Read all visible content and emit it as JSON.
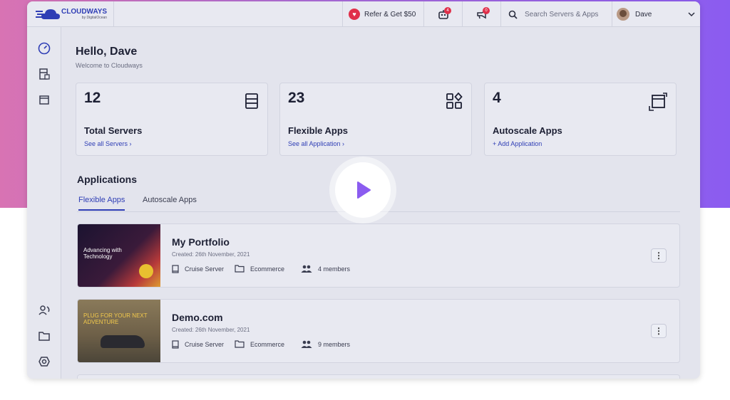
{
  "brand": {
    "name": "CLOUDWAYS",
    "sub": "by DigitalOcean"
  },
  "topbar": {
    "refer_label": "Refer & Get $50",
    "bot_badge": "4",
    "announce_badge": "0",
    "search_placeholder": "Search Servers & Apps",
    "user_name": "Dave"
  },
  "greeting": {
    "title": "Hello, Dave",
    "subtitle": "Welcome to Cloudways"
  },
  "stats": [
    {
      "value": "12",
      "label": "Total Servers",
      "link": "See all Servers ›"
    },
    {
      "value": "23",
      "label": "Flexible Apps",
      "link": "See all Application ›"
    },
    {
      "value": "4",
      "label": "Autoscale Apps",
      "link": "+ Add Application"
    }
  ],
  "applications": {
    "title": "Applications",
    "tabs": [
      "Flexible Apps",
      "Autoscale Apps"
    ],
    "items": [
      {
        "name": "My Portfolio",
        "created": "Created: 26th November, 2021",
        "server": "Cruise Server",
        "category": "Ecommerce",
        "members": "4 members",
        "thumb_text": "Advancing with Technology"
      },
      {
        "name": "Demo.com",
        "created": "Created: 26th November, 2021",
        "server": "Cruise Server",
        "category": "Ecommerce",
        "members": "9 members",
        "thumb_text": "PLUG FOR YOUR NEXT ADVENTURE"
      }
    ]
  },
  "colors": {
    "accent": "#2f3eb5",
    "badge": "#e0304a",
    "play": "#8b5cf0"
  }
}
